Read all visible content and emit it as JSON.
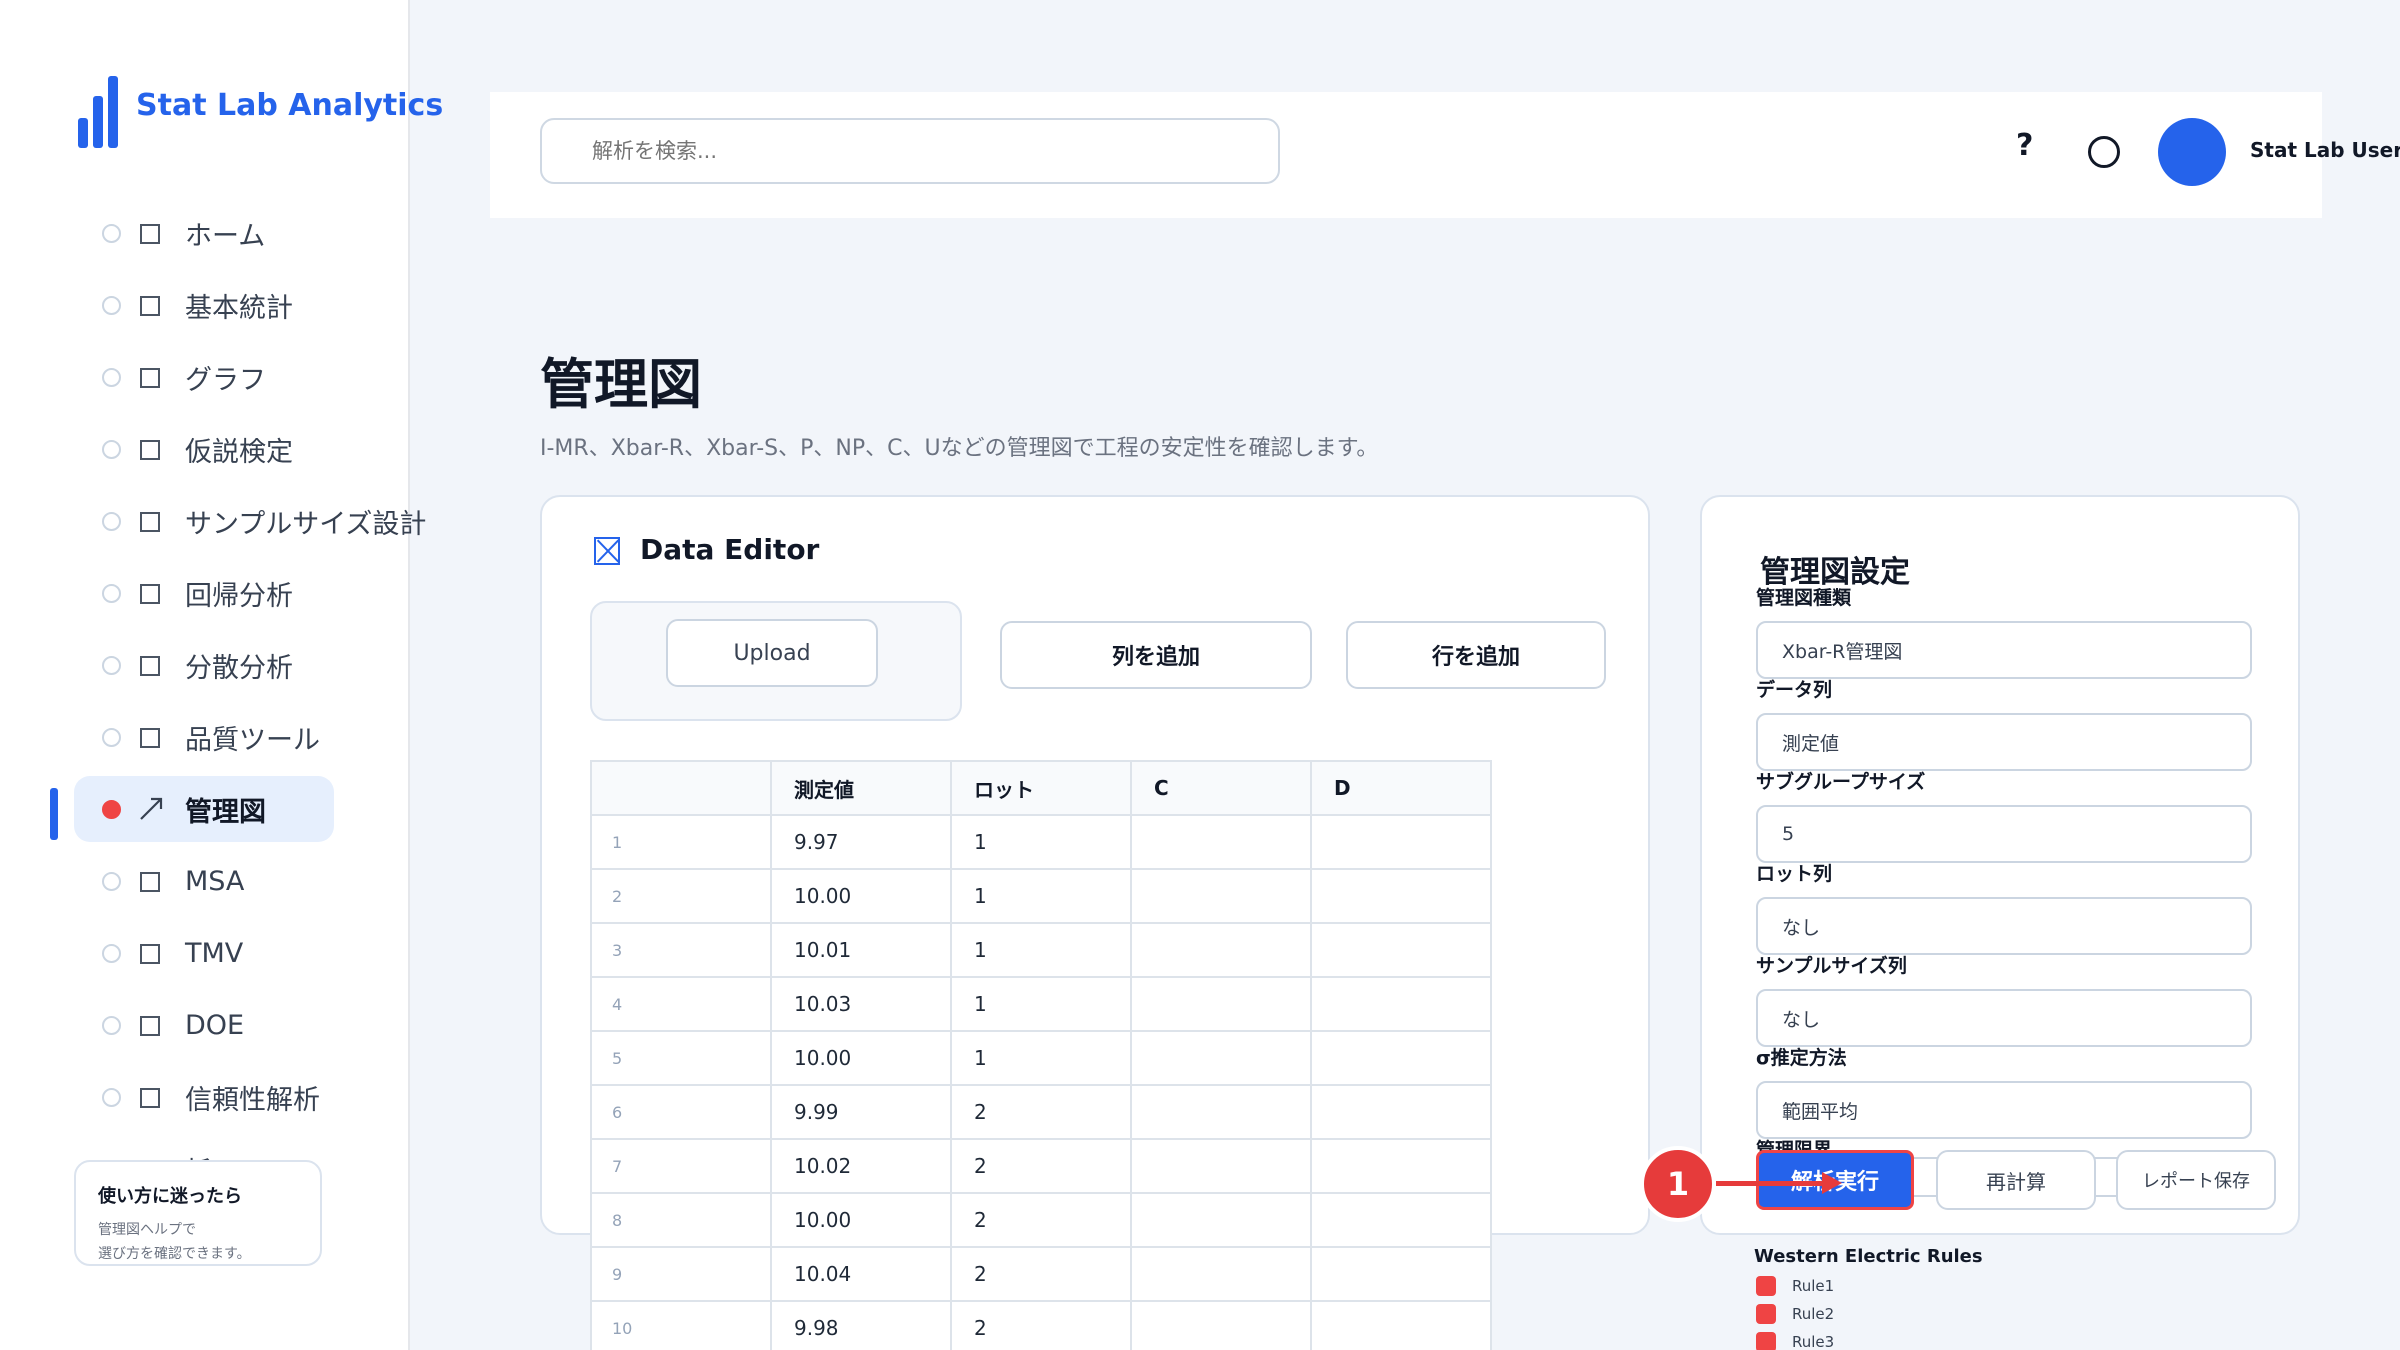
{
  "app": {
    "name": "Stat Lab Analytics"
  },
  "sidebar": {
    "items": [
      {
        "label": "ホーム",
        "icon": "square-icon",
        "active": false
      },
      {
        "label": "基本統計",
        "icon": "square-icon",
        "active": false
      },
      {
        "label": "グラフ",
        "icon": "square-icon",
        "active": false
      },
      {
        "label": "仮説検定",
        "icon": "square-icon",
        "active": false
      },
      {
        "label": "サンプルサイズ設計",
        "icon": "square-icon",
        "active": false
      },
      {
        "label": "回帰分析",
        "icon": "square-icon",
        "active": false
      },
      {
        "label": "分散分析",
        "icon": "square-icon",
        "active": false
      },
      {
        "label": "品質ツール",
        "icon": "square-icon",
        "active": false
      },
      {
        "label": "管理図",
        "icon": "arrow-icon",
        "active": true
      },
      {
        "label": "MSA",
        "icon": "square-icon",
        "active": false
      },
      {
        "label": "TMV",
        "icon": "square-icon",
        "active": false
      },
      {
        "label": "DOE",
        "icon": "square-icon",
        "active": false
      },
      {
        "label": "信頼性解析",
        "icon": "square-icon",
        "active": false
      },
      {
        "label": "析",
        "icon": "square-icon",
        "active": false
      }
    ],
    "help_card": {
      "title": "使い方に迷ったら",
      "line1": "管理図ヘルプで",
      "line2": "選び方を確認できます。"
    }
  },
  "topbar": {
    "search_placeholder": "解析を検索...",
    "help_label": "?",
    "user_name": "Stat Lab User"
  },
  "page": {
    "title": "管理図",
    "subtitle": "I-MR、Xbar-R、Xbar-S、P、NP、C、Uなどの管理図で工程の安定性を確認します。"
  },
  "editor": {
    "title": "Data Editor",
    "upload_label": "Upload",
    "add_column_label": "列を追加",
    "add_row_label": "行を追加",
    "columns": [
      "",
      "測定値",
      "ロット",
      "C",
      "D"
    ],
    "rows": [
      [
        "1",
        "9.97",
        "1",
        "",
        ""
      ],
      [
        "2",
        "10.00",
        "1",
        "",
        ""
      ],
      [
        "3",
        "10.01",
        "1",
        "",
        ""
      ],
      [
        "4",
        "10.03",
        "1",
        "",
        ""
      ],
      [
        "5",
        "10.00",
        "1",
        "",
        ""
      ],
      [
        "6",
        "9.99",
        "2",
        "",
        ""
      ],
      [
        "7",
        "10.02",
        "2",
        "",
        ""
      ],
      [
        "8",
        "10.00",
        "2",
        "",
        ""
      ],
      [
        "9",
        "10.04",
        "2",
        "",
        ""
      ],
      [
        "10",
        "9.98",
        "2",
        "",
        ""
      ]
    ]
  },
  "settings": {
    "title": "管理図設定",
    "chart_type_label": "管理図種類",
    "chart_type_value": "Xbar-R管理図",
    "data_column_label": "データ列",
    "data_column_value": "測定値",
    "subgroup_size_label": "サブグループサイズ",
    "subgroup_size_value": "5",
    "lot_column_label": "ロット列",
    "lot_column_value": "なし",
    "sample_size_column_label": "サンプルサイズ列",
    "sample_size_column_value": "なし",
    "sigma_method_label": "σ推定方法",
    "sigma_method_value": "範囲平均",
    "control_limits_label": "管理限界",
    "run_label": "解析実行",
    "recalc_label": "再計算",
    "save_report_label": "レポート保存",
    "rules_title": "Western Electric Rules",
    "rules": [
      "Rule1",
      "Rule2",
      "Rule3"
    ]
  },
  "annotation": {
    "step": "1"
  },
  "colors": {
    "accent": "#2563eb",
    "alert": "#ef4444"
  }
}
